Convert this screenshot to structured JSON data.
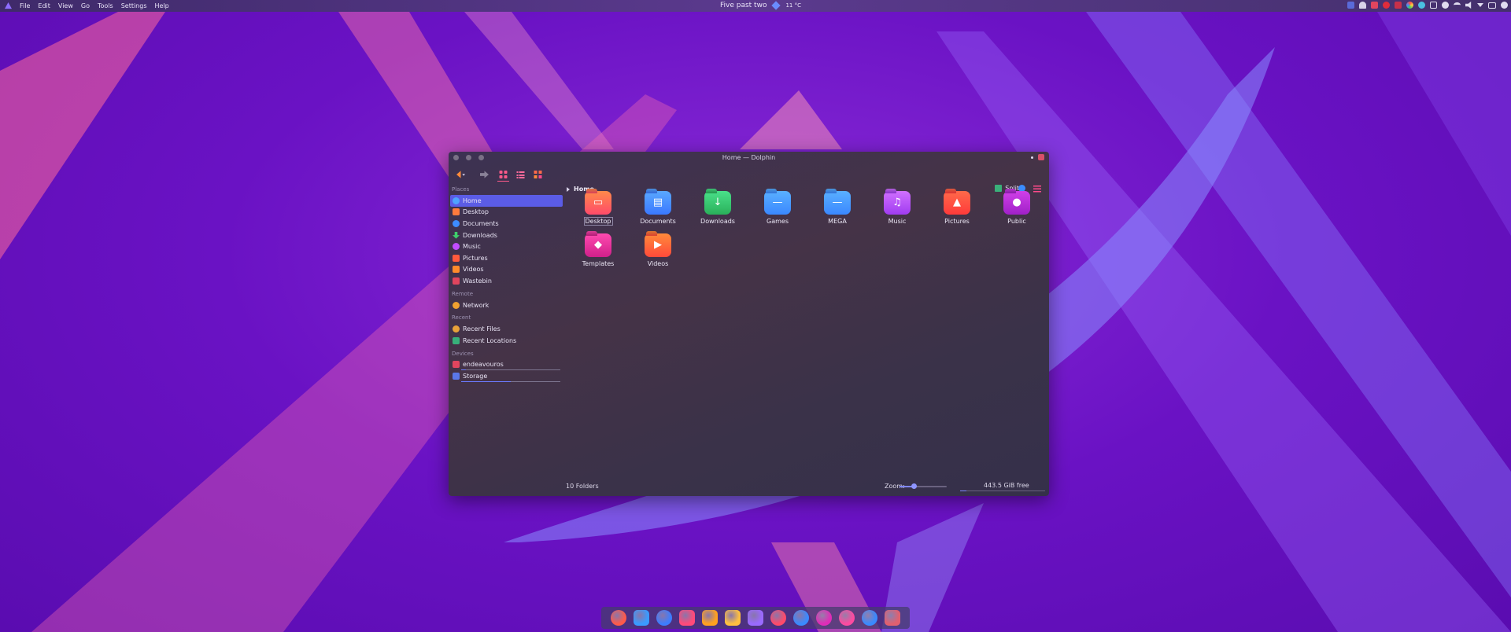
{
  "menubar": {
    "items": [
      "File",
      "Edit",
      "View",
      "Go",
      "Tools",
      "Settings",
      "Help"
    ]
  },
  "clock": {
    "time": "Five past two",
    "weather": "11 °C"
  },
  "window": {
    "title": "Home — Dolphin",
    "breadcrumb": "Home",
    "split_label": "Split"
  },
  "sidebar": {
    "places_header": "Places",
    "places": [
      {
        "label": "Home",
        "icon": "home-icon",
        "color": "#4fa3ff"
      },
      {
        "label": "Desktop",
        "icon": "desktop-icon",
        "color": "#ff7a3d"
      },
      {
        "label": "Documents",
        "icon": "documents-icon",
        "color": "#3d8cff"
      },
      {
        "label": "Downloads",
        "icon": "downloads-icon",
        "color": "#3ecf6b"
      },
      {
        "label": "Music",
        "icon": "music-icon",
        "color": "#c14cff"
      },
      {
        "label": "Pictures",
        "icon": "pictures-icon",
        "color": "#ff5a3c"
      },
      {
        "label": "Videos",
        "icon": "videos-icon",
        "color": "#ff8b2b"
      },
      {
        "label": "Wastebin",
        "icon": "trash-icon",
        "color": "#e0455e"
      }
    ],
    "remote_header": "Remote",
    "remote": [
      {
        "label": "Network",
        "icon": "network-icon",
        "color": "#f0a030"
      }
    ],
    "recent_header": "Recent",
    "recent": [
      {
        "label": "Recent Files",
        "icon": "recent-files-icon",
        "color": "#e8a23a"
      },
      {
        "label": "Recent Locations",
        "icon": "recent-locations-icon",
        "color": "#38b07a"
      }
    ],
    "devices_header": "Devices",
    "devices": [
      {
        "label": "endeavouros",
        "icon": "drive-icon",
        "color": "#e0455e",
        "usage": 0.05
      },
      {
        "label": "Storage",
        "icon": "storage-icon",
        "color": "#5a78e8",
        "usage": 0.5
      }
    ]
  },
  "folders": [
    {
      "label": "Desktop",
      "icon": "desktop-folder-icon",
      "color": "#ff6a3a"
    },
    {
      "label": "Documents",
      "icon": "documents-folder-icon",
      "color": "#3f8cff"
    },
    {
      "label": "Downloads",
      "icon": "downloads-folder-icon",
      "color": "#2fd06a"
    },
    {
      "label": "Games",
      "icon": "games-folder-icon",
      "color": "#3d9bff"
    },
    {
      "label": "MEGA",
      "icon": "mega-folder-icon",
      "color": "#3d9bff"
    },
    {
      "label": "Music",
      "icon": "music-folder-icon",
      "color": "#b84cff"
    },
    {
      "label": "Pictures",
      "icon": "pictures-folder-icon",
      "color": "#ff4a3a"
    },
    {
      "label": "Public",
      "icon": "public-folder-icon",
      "color": "#c02cd8"
    },
    {
      "label": "Templates",
      "icon": "templates-folder-icon",
      "color": "#e02c9a"
    },
    {
      "label": "Videos",
      "icon": "videos-folder-icon",
      "color": "#ff6a2a"
    }
  ],
  "status": {
    "count": "10 Folders",
    "zoom_label": "Zoom:",
    "zoom_level": 0.3,
    "free_space": "443.5 GiB free"
  },
  "dock": {
    "apps": [
      {
        "icon": "firefox-icon",
        "color": "#ff5a4a"
      },
      {
        "icon": "telegram-icon",
        "color": "#3a9bff"
      },
      {
        "icon": "browser-icon",
        "color": "#3d7dff"
      },
      {
        "icon": "editor-icon",
        "color": "#ff4a7a"
      },
      {
        "icon": "vlc-icon",
        "color": "#ffa020"
      },
      {
        "icon": "shield-icon",
        "color": "#ffc040"
      },
      {
        "icon": "tasks-icon",
        "color": "#9a6aff"
      },
      {
        "icon": "heart-app-icon",
        "color": "#ff4a6a"
      },
      {
        "icon": "gem-icon",
        "color": "#3a8aff"
      },
      {
        "icon": "spiral-icon",
        "color": "#e02cb8"
      },
      {
        "icon": "circle-app-icon",
        "color": "#ff4aa0"
      },
      {
        "icon": "steam-icon",
        "color": "#3a8aff"
      },
      {
        "icon": "files-icon",
        "color": "#e06070"
      }
    ]
  }
}
